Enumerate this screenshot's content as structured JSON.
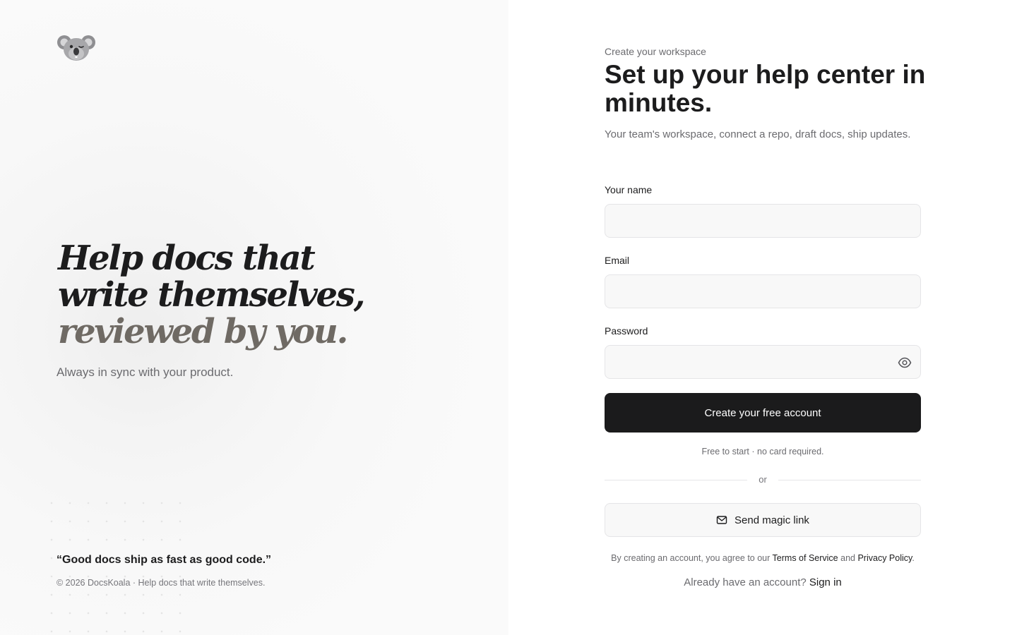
{
  "brand": {
    "logo_icon": "koala-icon"
  },
  "hero": {
    "line1": "Help docs that",
    "line2": "write themselves,",
    "line3": "reviewed by you.",
    "subtitle": "Always in sync with your product."
  },
  "footer": {
    "quote": "“Good docs ship as fast as good code.”",
    "copyright": "© 2026 DocsKoala · Help docs that write themselves."
  },
  "form": {
    "eyebrow": "Create your workspace",
    "title": "Set up your help center in minutes.",
    "subtitle": "Your team's workspace, connect a repo, draft docs, ship updates.",
    "name_label": "Your name",
    "name_value": "",
    "email_label": "Email",
    "email_value": "",
    "password_label": "Password",
    "password_value": "",
    "password_toggle_icon": "eye-icon",
    "submit_label": "Create your free account",
    "note": "Free to start · no card required.",
    "divider_label": "or",
    "magic_link_icon": "mail-icon",
    "magic_link_label": "Send magic link",
    "legal_prefix": "By creating an account, you agree to our",
    "terms_label": "Terms of Service",
    "legal_and": "and",
    "privacy_label": "Privacy Policy",
    "legal_suffix": ".",
    "signin_prompt": "Already have an account?",
    "signin_label": "Sign in"
  },
  "colors": {
    "primary_button": "#1b1b1c",
    "text": "#1c1c1d",
    "muted_text": "#6b6b6f",
    "hero_accent": "#6f6a64",
    "field_background": "#f8f8f8",
    "border": "#e5e5e7"
  }
}
